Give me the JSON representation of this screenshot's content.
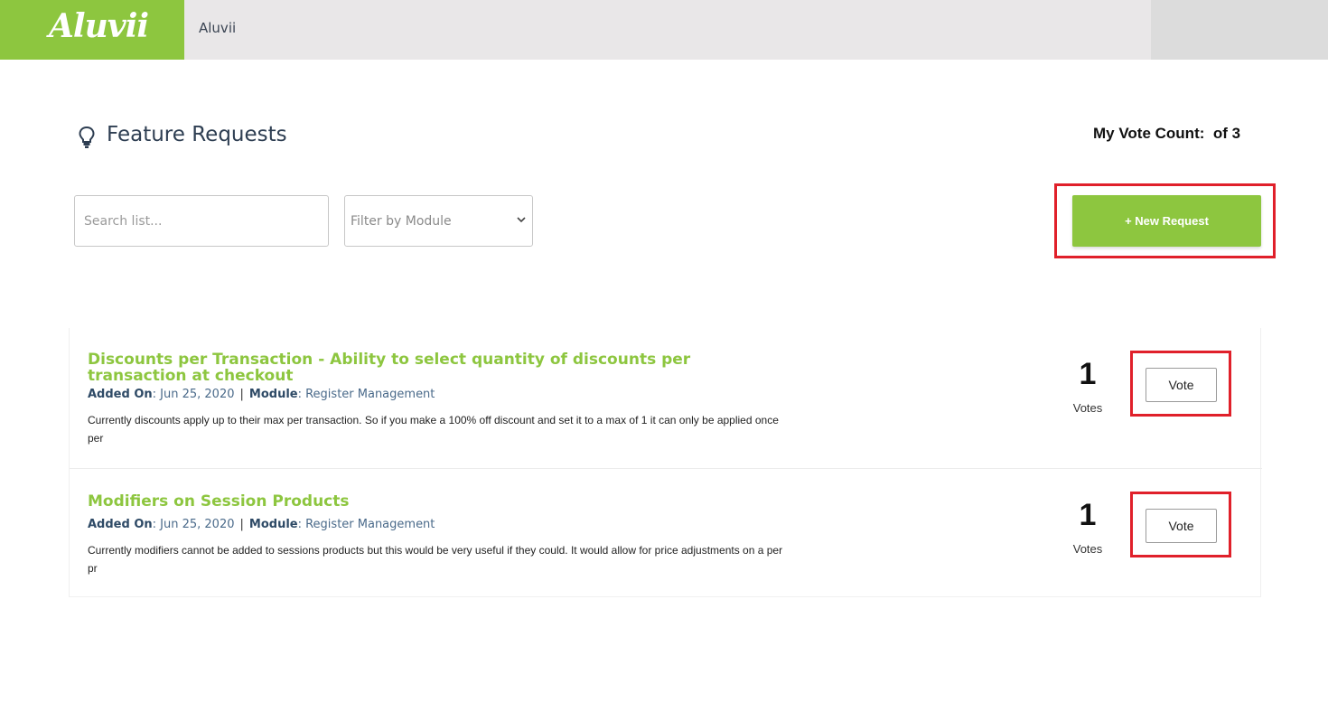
{
  "header": {
    "logo_text": "Aluvii",
    "org_name": "Aluvii"
  },
  "page": {
    "title": "Feature Requests",
    "vote_count_label": "My Vote Count:  of 3",
    "search_placeholder": "Search list...",
    "filter_label": "Filter by Module",
    "new_request_label": "+ New Request"
  },
  "requests": [
    {
      "title": "Discounts per Transaction - Ability to select quantity of discounts per transaction at checkout",
      "added_on_label": "Added On",
      "added_on": ": Jun 25, 2020",
      "separator": "|",
      "module_label": "Module",
      "module": ": Register Management",
      "description": "Currently discounts apply up to their max per transaction. So if you make a 100% off discount and set it to a max of 1 it can only be applied once per",
      "votes": "1",
      "votes_label": "Votes",
      "vote_button": "Vote"
    },
    {
      "title": "Modifiers on Session Products",
      "added_on_label": "Added On",
      "added_on": ": Jun 25, 2020",
      "separator": "|",
      "module_label": "Module",
      "module": ": Register Management",
      "description": "Currently modifiers cannot be added to sessions products but this would be very useful if they could. It would allow for price adjustments on a per pr",
      "votes": "1",
      "votes_label": "Votes",
      "vote_button": "Vote"
    }
  ],
  "colors": {
    "brand_green": "#8dc63f",
    "highlight_red": "#e0202a",
    "title_navy": "#2e3e52"
  }
}
